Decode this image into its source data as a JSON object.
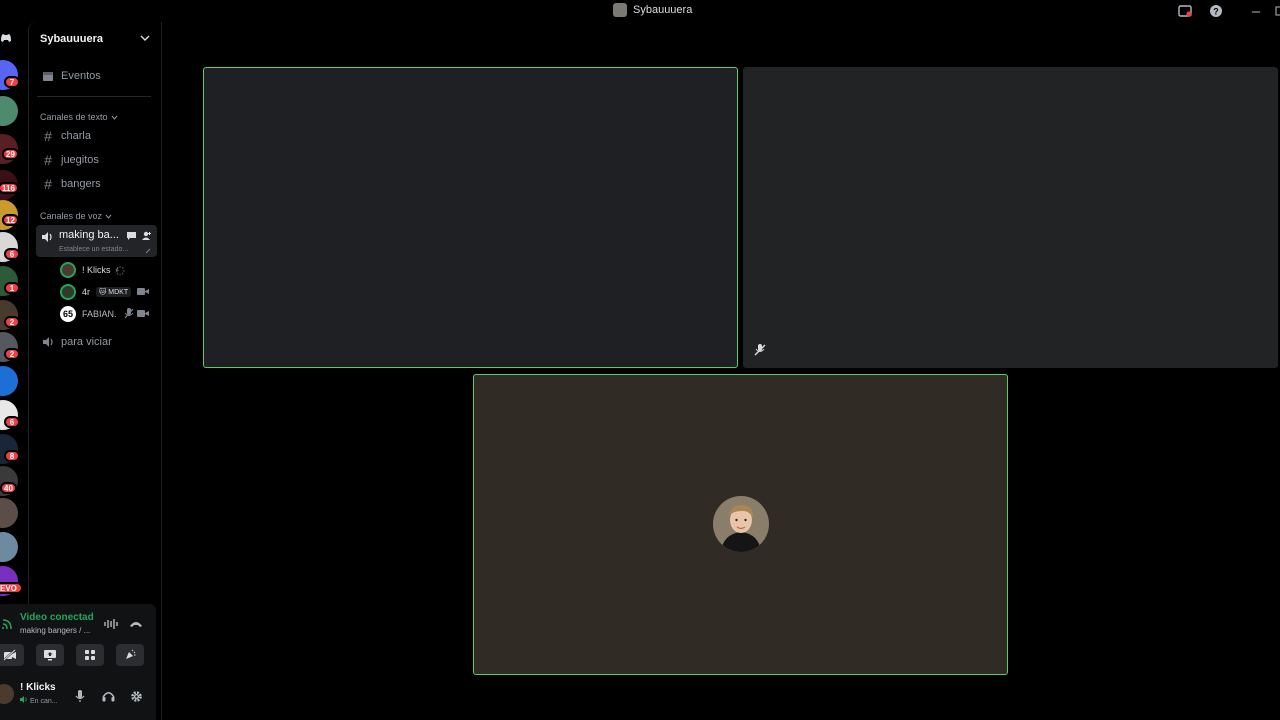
{
  "window": {
    "title": "Sybauuuera"
  },
  "rail": {
    "badges": [
      {
        "label": "7"
      },
      {
        "label": "29"
      },
      {
        "label": "116"
      },
      {
        "label": "12"
      },
      {
        "label": "6"
      },
      {
        "label": "1"
      },
      {
        "label": "2"
      },
      {
        "label": "2"
      },
      {
        "label": "6"
      },
      {
        "label": "8"
      },
      {
        "label": "40"
      },
      {
        "label": "EVO"
      }
    ]
  },
  "sidebar": {
    "server_name": "Sybauuuera",
    "events_label": "Eventos",
    "text_category": "Canales de texto",
    "text_channels": [
      "charla",
      "juegitos",
      "bangers"
    ],
    "voice_category": "Canales de voz",
    "active_voice": {
      "name": "making ba...",
      "status_placeholder": "Establece un estado..."
    },
    "members": [
      {
        "name": "! Klicks",
        "tag": "⚡꙰꙰"
      },
      {
        "name": "4r",
        "tag": "🐱 MDKT"
      },
      {
        "name": "FABIAN.",
        "avatar_text": "65"
      }
    ],
    "other_voice": "para viciar"
  },
  "voice_panel": {
    "status": "Video conectado",
    "channel": "making bangers / ...",
    "user_name": "! Klicks",
    "user_status": "En can..."
  },
  "colors": {
    "speaking_border": "#5ecb6a",
    "tile_dark": "#1f2023",
    "tile_dark2": "#222325",
    "tile_olive": "#302c25",
    "connected_green": "#23a55a"
  }
}
